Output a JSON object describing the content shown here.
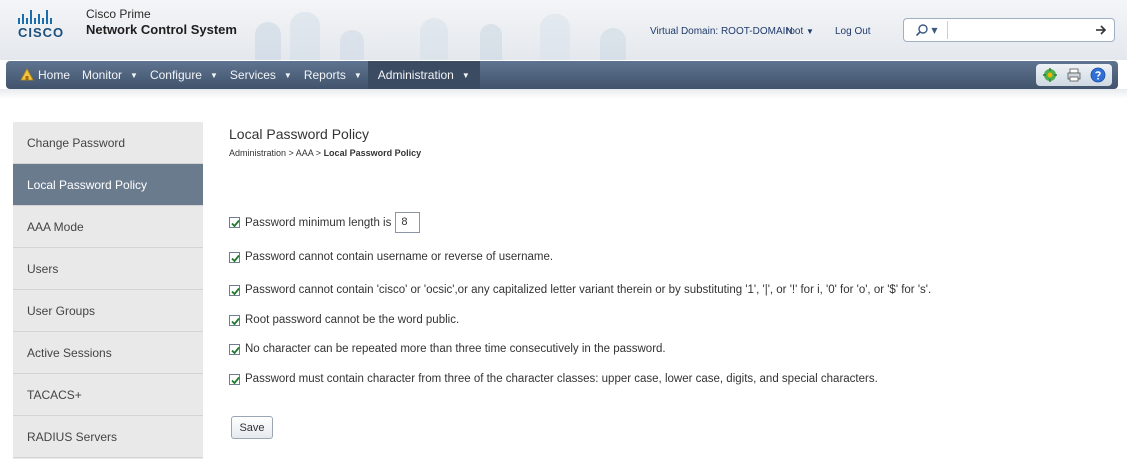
{
  "header": {
    "brand_line1": "Cisco Prime",
    "brand_line2": "Network Control System",
    "logo_text": "CISCO",
    "virtual_domain": "Virtual Domain: ROOT-DOMAIN",
    "user": "root",
    "logout": "Log Out",
    "search_value": ""
  },
  "nav": {
    "home": "Home",
    "items": [
      "Monitor",
      "Configure",
      "Services",
      "Reports",
      "Administration"
    ],
    "active": "Administration",
    "right_icons": [
      "settings-icon",
      "print-icon",
      "help-icon"
    ]
  },
  "sidebar": {
    "items": [
      "Change Password",
      "Local Password Policy",
      "AAA Mode",
      "Users",
      "User Groups",
      "Active Sessions",
      "TACACS+",
      "RADIUS Servers"
    ],
    "active_index": 1
  },
  "content": {
    "title": "Local Password Policy",
    "breadcrumb_prefix": "Administration > AAA > ",
    "breadcrumb_current": "Local Password Policy",
    "min_length_label": "Password minimum length is",
    "min_length_value": "8",
    "rules": [
      "Password cannot contain username or reverse of username.",
      "Password cannot contain 'cisco' or 'ocsic',or any capitalized letter variant therein or by substituting '1', '|', or '!' for i, '0' for 'o', or '$' for 's'.",
      "Root password cannot be the word public.",
      "No character can be repeated more than three time consecutively in the password.",
      "Password must contain character from three of the character classes: upper case, lower case, digits, and special characters."
    ],
    "save_label": "Save"
  },
  "colors": {
    "nav_bg": "#4a5d77",
    "sidebar_bg": "#e9e9e9",
    "sidebar_active": "#6b7b8e",
    "brand_blue": "#1b6fa8"
  }
}
